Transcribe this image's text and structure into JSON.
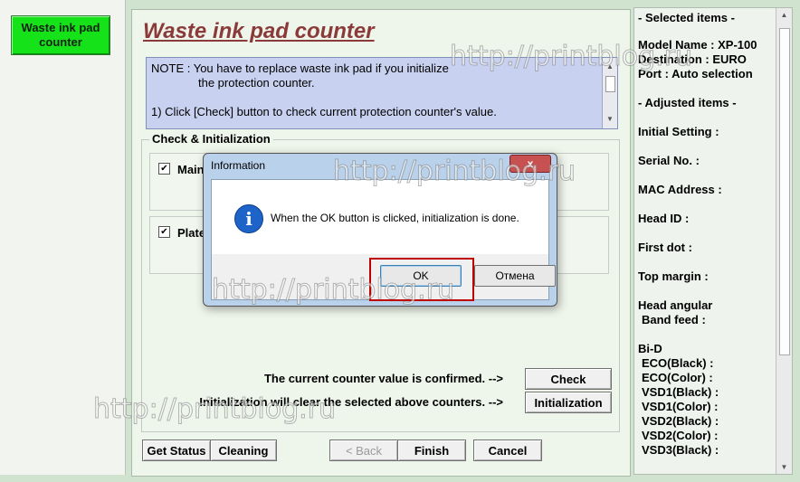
{
  "left": {
    "waste_button": "Waste ink pad counter"
  },
  "main": {
    "title": "Waste ink pad counter",
    "note_line1": "NOTE : You have to replace waste ink pad if you initialize",
    "note_line2": "the protection counter.",
    "note_line3": "1) Click [Check] button to check current protection counter's value.",
    "group_label": "Check & Initialization",
    "sub1_label": "Main",
    "sub2_label": "Plate",
    "confirm_text": "The current counter value is confirmed. -->",
    "init_text": "Initialization will clear the selected above counters. -->",
    "check_button": "Check",
    "init_button": "Initialization",
    "get_status": "Get Status",
    "cleaning": "Cleaning",
    "back": "< Back",
    "finish": "Finish",
    "cancel": "Cancel"
  },
  "right": {
    "selected_items": "- Selected items -",
    "model_name": "Model Name : XP-100",
    "destination": "Destination : EURO",
    "port": "Port : Auto selection",
    "adjusted_items": "- Adjusted items -",
    "initial_setting": "Initial Setting :",
    "serial_no": "Serial No. :",
    "mac_address": "MAC Address :",
    "head_id": "Head ID :",
    "first_dot": "First dot :",
    "top_margin": "Top margin :",
    "head_angular": "Head angular",
    "band_feed": "Band feed :",
    "bi_d": "Bi-D",
    "eco_black": "ECO(Black)  :",
    "eco_color": "ECO(Color)  :",
    "vsd1_black": "VSD1(Black) :",
    "vsd1_color": "VSD1(Color) :",
    "vsd2_black": "VSD2(Black) :",
    "vsd2_color": "VSD2(Color) :",
    "vsd3_black": "VSD3(Black) :"
  },
  "dialog": {
    "title": "Information",
    "close": "x",
    "icon_text": "i",
    "message": "When the OK button is clicked, initialization is done.",
    "ok": "OK",
    "cancel": "Отмена"
  },
  "watermark": "http://printblog.ru",
  "colors": {
    "waste_button": "#16e21a",
    "title": "#8b3a3a",
    "note_bg": "#c8d2f0",
    "highlight": "#c00000",
    "dialog_frame": "#b9d1ea"
  }
}
